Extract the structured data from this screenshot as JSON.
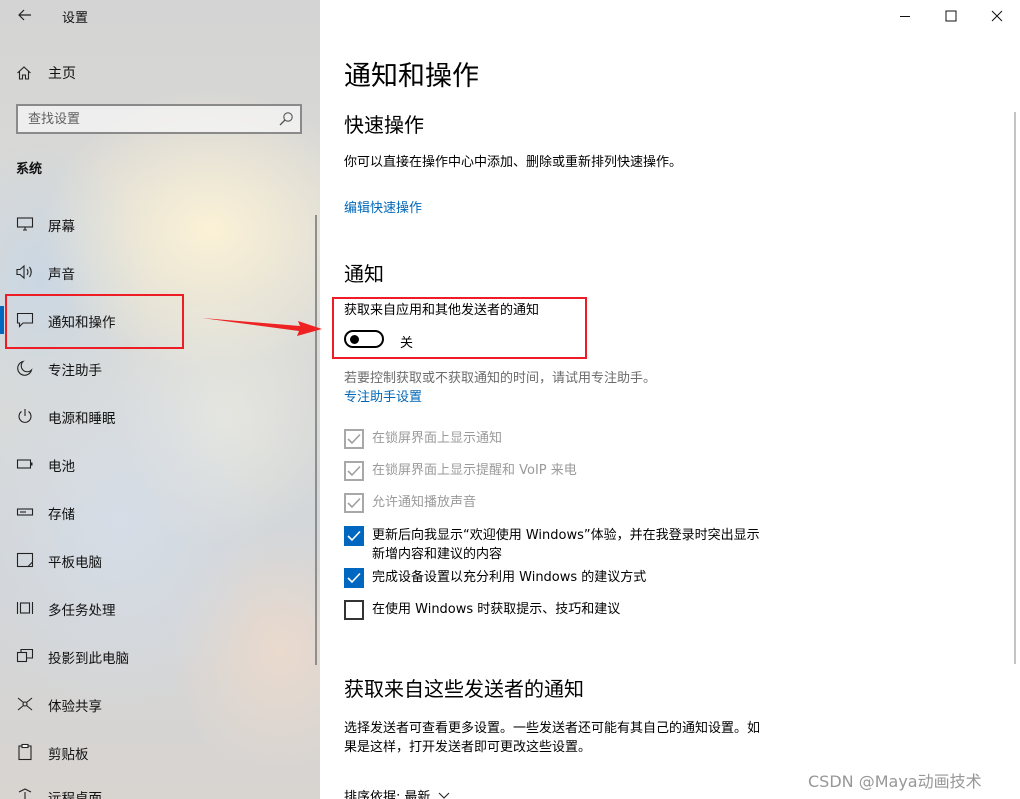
{
  "window": {
    "title": "设置",
    "minimize_icon": "minimize-icon",
    "maximize_icon": "maximize-icon",
    "close_icon": "close-icon"
  },
  "sidebar": {
    "home_label": "主页",
    "search_placeholder": "查找设置",
    "section_title": "系统",
    "selected_index": 2,
    "items": [
      {
        "label": "屏幕",
        "icon": "monitor-icon"
      },
      {
        "label": "声音",
        "icon": "speaker-icon"
      },
      {
        "label": "通知和操作",
        "icon": "message-icon"
      },
      {
        "label": "专注助手",
        "icon": "moon-icon"
      },
      {
        "label": "电源和睡眠",
        "icon": "power-icon"
      },
      {
        "label": "电池",
        "icon": "battery-icon"
      },
      {
        "label": "存储",
        "icon": "storage-icon"
      },
      {
        "label": "平板电脑",
        "icon": "tablet-icon"
      },
      {
        "label": "多任务处理",
        "icon": "multitask-icon"
      },
      {
        "label": "投影到此电脑",
        "icon": "project-icon"
      },
      {
        "label": "体验共享",
        "icon": "share-icon"
      },
      {
        "label": "剪贴板",
        "icon": "clipboard-icon"
      },
      {
        "label": "远程桌面",
        "icon": "remote-desktop-icon"
      }
    ]
  },
  "main": {
    "page_title": "通知和操作",
    "quick_actions": {
      "heading": "快速操作",
      "description": "你可以直接在操作中心中添加、删除或重新排列快速操作。",
      "edit_link": "编辑快速操作"
    },
    "notifications": {
      "heading": "通知",
      "toggle_label": "获取来自应用和其他发送者的通知",
      "toggle_state": "关",
      "toggle_on": false,
      "focus_hint": "若要控制获取或不获取通知的时间，请试用专注助手。",
      "focus_link": "专注助手设置",
      "checkboxes": [
        {
          "label": "在锁屏界面上显示通知",
          "checked": true,
          "enabled": false
        },
        {
          "label": "在锁屏界面上显示提醒和 VoIP 来电",
          "checked": true,
          "enabled": false
        },
        {
          "label": "允许通知播放声音",
          "checked": true,
          "enabled": false
        },
        {
          "label": "更新后向我显示“欢迎使用 Windows”体验，并在我登录时突出显示",
          "label2": "新增内容和建议的内容",
          "checked": true,
          "enabled": true
        },
        {
          "label": "完成设备设置以充分利用 Windows 的建议方式",
          "checked": true,
          "enabled": true
        },
        {
          "label": "在使用 Windows 时获取提示、技巧和建议",
          "checked": false,
          "enabled": true
        }
      ]
    },
    "senders": {
      "heading": "获取来自这些发送者的通知",
      "description_line1": "选择发送者可查看更多设置。一些发送者还可能有其自己的通知设置。如",
      "description_line2": "果是这样，打开发送者即可更改这些设置。",
      "sort_label": "排序依据:",
      "sort_value": "最新"
    }
  },
  "watermark": "CSDN @Maya动画技术",
  "colors": {
    "accent": "#0067c0",
    "link": "#0067b8",
    "highlight_red": "#ee1c24"
  }
}
